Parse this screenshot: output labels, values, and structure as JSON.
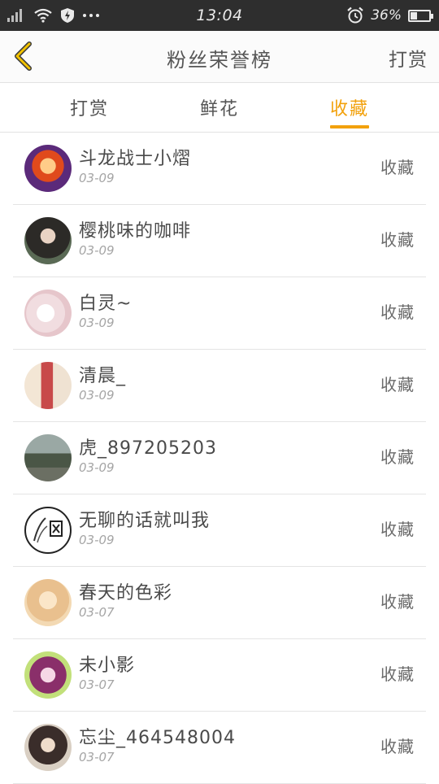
{
  "statusbar": {
    "time": "13:04",
    "battery": "36%",
    "battery_level": 0.36
  },
  "header": {
    "title": "粉丝荣誉榜",
    "action": "打赏"
  },
  "tabs": [
    {
      "label": "打赏",
      "active": false
    },
    {
      "label": "鲜花",
      "active": false
    },
    {
      "label": "收藏",
      "active": true
    }
  ],
  "fans": [
    {
      "name": "斗龙战士小熠",
      "date": "03-09",
      "action": "收藏"
    },
    {
      "name": "樱桃味的咖啡",
      "date": "03-09",
      "action": "收藏"
    },
    {
      "name": "白灵~",
      "date": "03-09",
      "action": "收藏"
    },
    {
      "name": "清晨_",
      "date": "03-09",
      "action": "收藏"
    },
    {
      "name": "虎_897205203",
      "date": "03-09",
      "action": "收藏"
    },
    {
      "name": "无聊的话就叫我",
      "date": "03-09",
      "action": "收藏"
    },
    {
      "name": "春天的色彩",
      "date": "03-07",
      "action": "收藏"
    },
    {
      "name": "未小影",
      "date": "03-07",
      "action": "收藏"
    },
    {
      "name": "忘尘_464548004",
      "date": "03-07",
      "action": "收藏"
    }
  ],
  "colors": {
    "accent": "#f2a10c",
    "statusbar_bg": "#2e2e2e"
  },
  "icons": {
    "back": "chevron-left-icon",
    "signal": "signal-icon",
    "wifi": "wifi-icon",
    "shield": "shield-icon",
    "more": "more-dots-icon",
    "alarm": "alarm-clock-icon",
    "battery": "battery-icon"
  }
}
